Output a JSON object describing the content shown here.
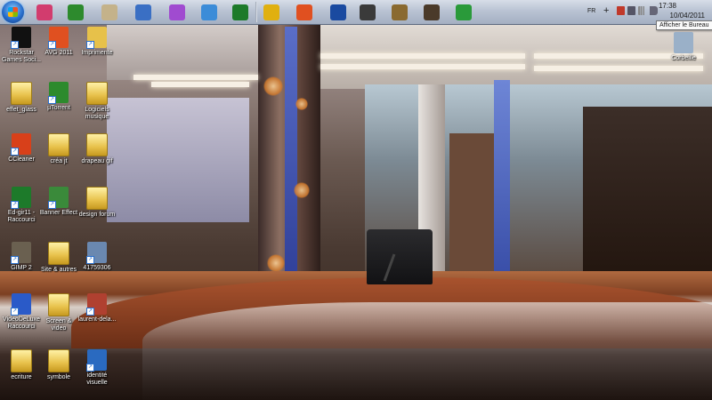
{
  "taskbar": {
    "start_icon": "windows-orb-icon",
    "pinned": [
      {
        "name": "pinned-colorful-app",
        "icon": "palette-icon",
        "color": "#d23c6e"
      },
      {
        "name": "pinned-utorrent",
        "icon": "utorrent-icon",
        "color": "#2d8a2d"
      },
      {
        "name": "pinned-notepad",
        "icon": "notepad-icon",
        "color": "#c4b28a"
      },
      {
        "name": "pinned-monitor",
        "icon": "monitor-icon",
        "color": "#3a6fc4"
      },
      {
        "name": "pinned-picasa",
        "icon": "pinwheel-icon",
        "color": "#a04bd0"
      },
      {
        "name": "pinned-messenger",
        "icon": "chat-icon",
        "color": "#3c8cd8"
      },
      {
        "name": "pinned-edgir",
        "icon": "e-green-icon",
        "color": "#1d7a2a"
      },
      {
        "name": "pinned-chrome",
        "icon": "chrome-icon",
        "color": "#e0b010"
      },
      {
        "name": "pinned-avg",
        "icon": "avg-icon",
        "color": "#e05020"
      },
      {
        "name": "pinned-plane",
        "icon": "plane-icon",
        "color": "#1a4aa0"
      },
      {
        "name": "pinned-99",
        "icon": "badge-99-icon",
        "color": "#3a3a3a"
      },
      {
        "name": "pinned-gimp",
        "icon": "gimp-icon",
        "color": "#8a6a30"
      },
      {
        "name": "pinned-film",
        "icon": "film-icon",
        "color": "#4a3a2a"
      },
      {
        "name": "pinned-contacts",
        "icon": "contacts-icon",
        "color": "#2a9a3a"
      }
    ],
    "tray": {
      "language": "FR",
      "time": "17:38",
      "date": "10/04/2011",
      "tooltip": "Afficher le Bureau"
    }
  },
  "desktop": {
    "icons": [
      {
        "name": "rockstar-games",
        "label": "Rockstar Games Soci...",
        "icon": "rockstar-icon",
        "color": "#111111"
      },
      {
        "name": "avg-2011",
        "label": "AVG 2011",
        "icon": "avg-icon",
        "color": "#e05020"
      },
      {
        "name": "imprimente",
        "label": "Imprimente",
        "icon": "printer-icon",
        "color": "#e7c14a"
      },
      {
        "name": "effet-glass",
        "label": "effet_glass",
        "icon": "folder-icon",
        "color": "#e7c14a"
      },
      {
        "name": "utorrent",
        "label": "µTorrent",
        "icon": "utorrent-icon",
        "color": "#2d8a2d"
      },
      {
        "name": "logiciels-musique",
        "label": "Logiciels musique",
        "icon": "folder-icon",
        "color": "#e7c14a"
      },
      {
        "name": "ccleaner",
        "label": "CCleaner",
        "icon": "ccleaner-icon",
        "color": "#d8401a"
      },
      {
        "name": "crea-jt",
        "label": "créa jt",
        "icon": "folder-icon",
        "color": "#e7c14a"
      },
      {
        "name": "drapeau-gif",
        "label": "drapeau gif",
        "icon": "folder-icon",
        "color": "#e7c14a"
      },
      {
        "name": "ed-gir11",
        "label": "Ed-gir11 - Raccourci",
        "icon": "e-green-icon",
        "color": "#1d7a2a"
      },
      {
        "name": "banner-effect",
        "label": "Banner Effect",
        "icon": "banner-icon",
        "color": "#3a8a3a"
      },
      {
        "name": "design-forum",
        "label": "design forum",
        "icon": "folder-icon",
        "color": "#e7c14a"
      },
      {
        "name": "gimp-2",
        "label": "GIMP 2",
        "icon": "gimp-icon",
        "color": "#6a6050"
      },
      {
        "name": "site-et-autres",
        "label": "Site & autres",
        "icon": "folder-icon",
        "color": "#e7c14a"
      },
      {
        "name": "file-41759306",
        "label": "41759306",
        "icon": "photo-icon",
        "color": "#6a88b0"
      },
      {
        "name": "videodelux",
        "label": "VideoDeLuxe Raccourci",
        "icon": "video-deluxe-icon",
        "color": "#2a5ac8"
      },
      {
        "name": "screen-et-video",
        "label": "Screen & video",
        "icon": "folder-icon",
        "color": "#e7c14a"
      },
      {
        "name": "laurent-dela",
        "label": "laurent-dela...",
        "icon": "photo-icon",
        "color": "#b04030"
      },
      {
        "name": "ecriture",
        "label": "ecriture",
        "icon": "folder-icon",
        "color": "#e7c14a"
      },
      {
        "name": "symbole",
        "label": "symbole",
        "icon": "folder-icon",
        "color": "#e7c14a"
      },
      {
        "name": "identite-visuelle",
        "label": "identité visuelle",
        "icon": "video-file-icon",
        "color": "#2a6ac0"
      },
      {
        "name": "corbeille",
        "label": "Corbeille",
        "icon": "recycle-bin-icon",
        "color": "#9ab0c8"
      }
    ]
  }
}
